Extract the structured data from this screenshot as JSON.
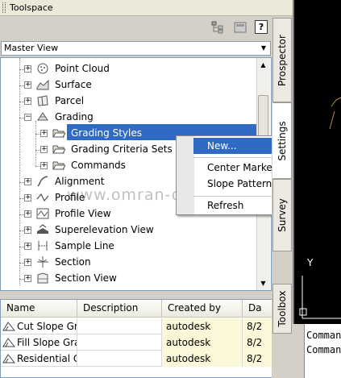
{
  "window": {
    "title": "Toolspace"
  },
  "toolbar": {
    "icons": [
      "tree-view-icon",
      "panel-toggle-icon",
      "help-icon"
    ],
    "help_label": "?"
  },
  "view_select": {
    "value": "Master View",
    "arrow": "▼"
  },
  "tree": {
    "items": [
      {
        "label": "Point Cloud",
        "icon": "point-cloud-icon",
        "expander": "+"
      },
      {
        "label": "Surface",
        "icon": "surface-icon",
        "expander": "+"
      },
      {
        "label": "Parcel",
        "icon": "parcel-icon",
        "expander": "+"
      },
      {
        "label": "Grading",
        "icon": "grading-icon",
        "expander": "−"
      },
      {
        "label": "Grading Styles",
        "icon": "folder-open-icon",
        "expander": "+",
        "selected": true
      },
      {
        "label": "Grading Criteria Sets",
        "icon": "folder-open-icon",
        "expander": "+"
      },
      {
        "label": "Commands",
        "icon": "folder-open-icon",
        "expander": "+"
      },
      {
        "label": "Alignment",
        "icon": "alignment-icon",
        "expander": "+"
      },
      {
        "label": "Profile",
        "icon": "profile-icon",
        "expander": "+"
      },
      {
        "label": "Profile View",
        "icon": "profile-view-icon",
        "expander": "+"
      },
      {
        "label": "Superelevation View",
        "icon": "superelevation-icon",
        "expander": "+"
      },
      {
        "label": "Sample Line",
        "icon": "sample-line-icon",
        "expander": "+"
      },
      {
        "label": "Section",
        "icon": "section-icon",
        "expander": "+"
      },
      {
        "label": "Section View",
        "icon": "section-view-icon",
        "expander": "+"
      }
    ]
  },
  "context_menu": {
    "items": [
      "New...",
      "Center Markers On/Off",
      "Slope Patterns On/Off",
      "Refresh"
    ]
  },
  "watermark": "www.omran-omran.com",
  "list": {
    "columns": [
      "Name",
      "Description",
      "Created by",
      "Da"
    ],
    "rows": [
      {
        "name": "Cut Slope Gra(",
        "description": "",
        "created_by": "autodesk",
        "date": "8/2"
      },
      {
        "name": "Fill Slope Grad",
        "description": "",
        "created_by": "autodesk",
        "date": "8/2"
      },
      {
        "name": "Residential G",
        "description": "",
        "created_by": "autodesk",
        "date": "8/2"
      }
    ]
  },
  "side_tabs": [
    "Prospector",
    "Settings",
    "Survey",
    "Toolbox"
  ],
  "cad": {
    "axis_label": "Y"
  },
  "command_lines": [
    "Comman",
    "Comman"
  ],
  "colors": {
    "selection": "#316ac5",
    "panel": "#d4d0c8",
    "cad_background": "#000000",
    "yellow_cell": "#fbf8d9"
  }
}
